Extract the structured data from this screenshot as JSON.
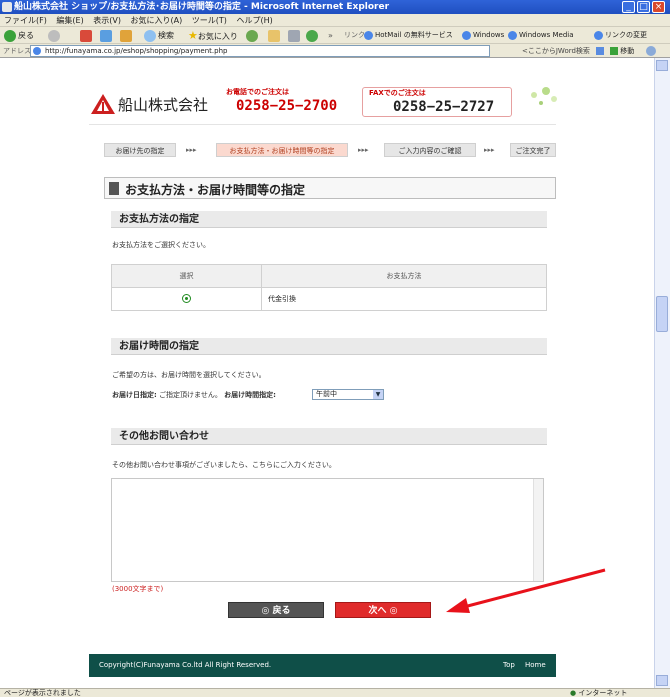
{
  "window": {
    "title": "船山株式会社 ショップ/お支払方法･お届け時間等の指定 - Microsoft Internet Explorer",
    "controls": [
      "_",
      "□",
      "×"
    ]
  },
  "menu": [
    "ファイル(F)",
    "編集(E)",
    "表示(V)",
    "お気に入り(A)",
    "ツール(T)",
    "ヘルプ(H)"
  ],
  "toolbar": {
    "back": "戻る",
    "search": "検索",
    "favorites": "お気に入り",
    "links_label": "リンク",
    "links": [
      "HotMail の無料サービス",
      "Windows",
      "Windows Media",
      "リンクの変更"
    ]
  },
  "address": {
    "label": "アドレス(D)",
    "url": "http://funayama.co.jp/eshop/shopping/payment.php",
    "search_label": "<ここからJWord検索",
    "go": "移動"
  },
  "header": {
    "company": "船山株式会社",
    "tel_label": "お電話でのご注文は",
    "tel": "0258−25−2700",
    "fax_label": "FAXでのご注文は",
    "fax": "0258−25−2727"
  },
  "steps": [
    {
      "label": "お届け先の指定",
      "active": false
    },
    {
      "label": "お支払方法・お届け時間等の指定",
      "active": true
    },
    {
      "label": "ご入力内容のご確認",
      "active": false
    },
    {
      "label": "ご注文完了",
      "active": false
    }
  ],
  "step_arrow": "▸▸▸",
  "page_title": "お支払方法・お届け時間等の指定",
  "payment": {
    "heading": "お支払方法の指定",
    "instruction": "お支払方法をご選択ください。",
    "col_select": "選択",
    "col_method": "お支払方法",
    "method": "代金引換"
  },
  "delivery": {
    "heading": "お届け時間の指定",
    "instruction": "ご希望の方は、お届け時間を選択してください。",
    "date_label": "お届け日指定:",
    "date_value": "ご指定頂けません。",
    "time_label": "お届け時間指定:",
    "time_value": "午前中"
  },
  "inquiry": {
    "heading": "その他お問い合わせ",
    "instruction": "その他お問い合わせ事項がございましたら、こちらにご入力ください。",
    "limit": "(3000文字まで)"
  },
  "buttons": {
    "back": "戻る",
    "next": "次へ"
  },
  "footer": {
    "copyright": "Copyright(C)Funayama Co.ltd All Right Reserved.",
    "top": "Top",
    "home": "Home"
  },
  "status": {
    "left": "ページが表示されました",
    "right": "インターネット"
  }
}
